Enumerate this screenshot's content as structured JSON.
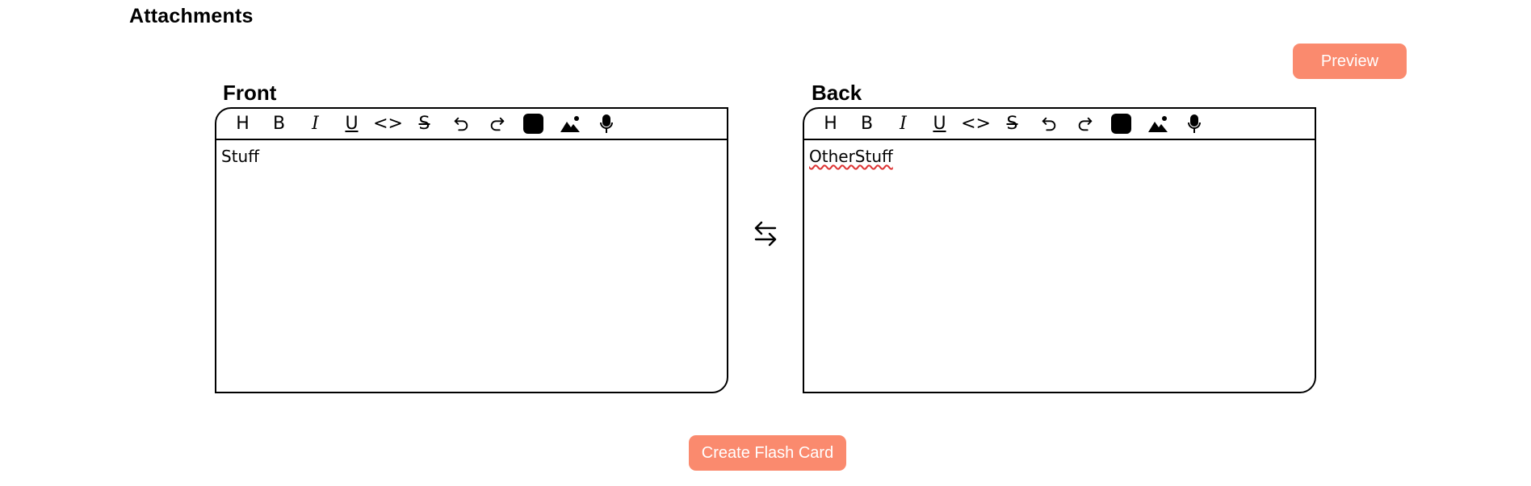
{
  "page": {
    "attachments_heading": "Attachments",
    "preview_label": "Preview",
    "create_label": "Create Flash Card",
    "accent_color": "#fa8a6e"
  },
  "toolbar": {
    "heading": "H",
    "bold": "B",
    "italic": "I",
    "underline": "U",
    "code": "<>",
    "strike": "S",
    "icons": [
      "heading-icon",
      "bold-icon",
      "italic-icon",
      "underline-icon",
      "code-icon",
      "strikethrough-icon",
      "undo-icon",
      "redo-icon",
      "color-icon",
      "image-icon",
      "microphone-icon"
    ]
  },
  "front": {
    "label": "Front",
    "content": "Stuff"
  },
  "back": {
    "label": "Back",
    "content": "OtherStuff"
  },
  "swap": {
    "icon": "swap-icon"
  }
}
